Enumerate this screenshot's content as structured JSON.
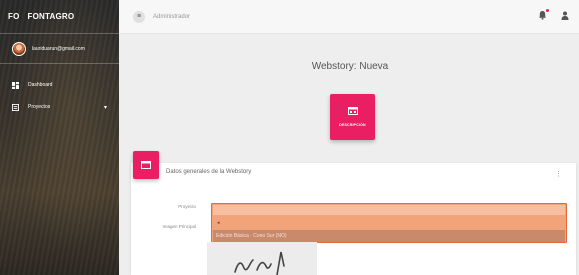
{
  "brand": {
    "mini": "FO",
    "name": "FONTAGRO"
  },
  "user": {
    "email": "lauriduarun@gmail.com"
  },
  "sidebar": {
    "items": [
      {
        "label": "Dashboard",
        "icon": "dashboard-icon"
      },
      {
        "label": "Proyectos",
        "icon": "folder-icon",
        "caret": "▾"
      }
    ]
  },
  "topbar": {
    "menu_icon": "≡",
    "title": "Administrador"
  },
  "page": {
    "title": "Webstory: Nueva"
  },
  "desc_card": {
    "label": "DESCRIPCIÓN"
  },
  "panel": {
    "title": "Datos generales de la Webstory",
    "menu_glyph": "⋮",
    "fields": {
      "proyecto_label": "Proyecto",
      "imagen_label": "Imagen Principal",
      "select_marker": "◂",
      "option_highlighted": "Edición Básica · Cono Sur (NO)"
    }
  },
  "colors": {
    "accent": "#e91e63",
    "highlight": "#f1a37a",
    "sidebar": "#2f2b26"
  }
}
